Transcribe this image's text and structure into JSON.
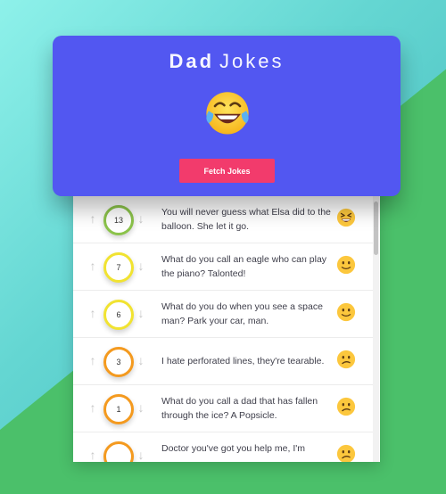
{
  "header": {
    "title_bold": "Dad",
    "title_light": "Jokes",
    "emoji_icon": "laughing-tears-emoji",
    "fetch_label": "Fetch Jokes"
  },
  "colors": {
    "panel": "#5257f1",
    "button": "#f23b6c",
    "background_teal": "#64d6d2",
    "background_green": "#4bc06a"
  },
  "jokes": [
    {
      "votes": "13",
      "text": "You will never guess what Elsa did to the balloon. She let it go.",
      "ring_color": "#8bc34a",
      "emoji": "grinning-squint-emoji"
    },
    {
      "votes": "7",
      "text": "What do you call an eagle who can play the piano? Talonted!",
      "ring_color": "#f1e331",
      "emoji": "slight-smile-emoji"
    },
    {
      "votes": "6",
      "text": "What do you do when you see a space man? Park your car, man.",
      "ring_color": "#f1e331",
      "emoji": "slight-smile-emoji"
    },
    {
      "votes": "3",
      "text": "I hate perforated lines, they're tearable.",
      "ring_color": "#f49a1f",
      "emoji": "confused-emoji"
    },
    {
      "votes": "1",
      "text": "What do you call a dad that has fallen through the ice? A Popsicle.",
      "ring_color": "#f49a1f",
      "emoji": "confused-emoji"
    },
    {
      "votes": "",
      "text": "Doctor you've got you help me, I'm",
      "ring_color": "#f49a1f",
      "emoji": "confused-emoji"
    }
  ]
}
